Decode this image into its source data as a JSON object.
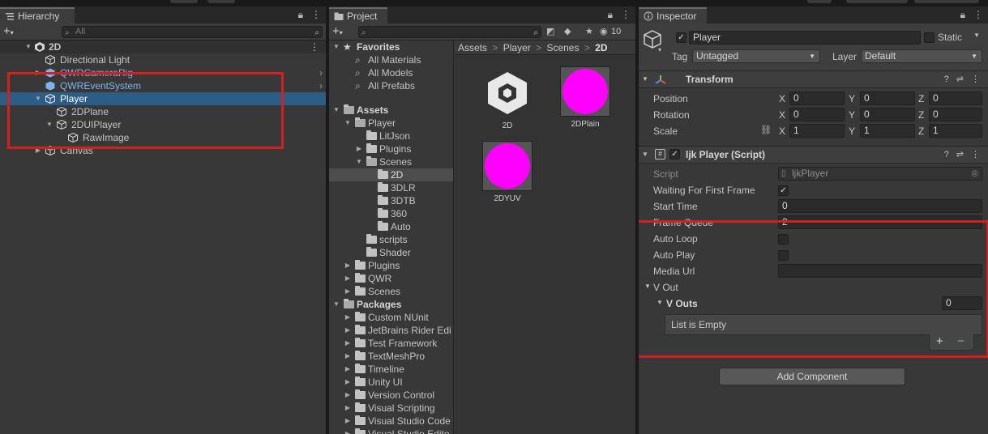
{
  "hierarchy": {
    "tab_label": "Hierarchy",
    "search_placeholder": "All",
    "scene_name": "2D",
    "items": [
      {
        "label": "Directional Light"
      },
      {
        "label": "QWRCameraRig"
      },
      {
        "label": "QWREventSystem"
      },
      {
        "label": "Player"
      },
      {
        "label": "2DPlane"
      },
      {
        "label": "2DUIPlayer"
      },
      {
        "label": "RawImage"
      },
      {
        "label": "Canvas"
      }
    ]
  },
  "project": {
    "tab_label": "Project",
    "hidden_count": "10",
    "favorites_label": "Favorites",
    "favorites": [
      "All Materials",
      "All Models",
      "All Prefabs"
    ],
    "assets_label": "Assets",
    "tree": [
      "Player",
      "LitJson",
      "Plugins",
      "Scenes",
      "2D",
      "3DLR",
      "3DTB",
      "360",
      "Auto",
      "scripts",
      "Shader",
      "Plugins",
      "QWR",
      "Scenes"
    ],
    "packages_label": "Packages",
    "packages": [
      "Custom NUnit",
      "JetBrains Rider Edi",
      "Test Framework",
      "TextMeshPro",
      "Timeline",
      "Unity UI",
      "Version Control",
      "Visual Scripting",
      "Visual Studio Code",
      "Visual Studio Edito"
    ],
    "breadcrumb": [
      "Assets",
      "Player",
      "Scenes",
      "2D"
    ],
    "breadcrumb_sep": ">",
    "assets": [
      {
        "label": "2D"
      },
      {
        "label": "2DPlain"
      },
      {
        "label": "2DYUV"
      }
    ]
  },
  "inspector": {
    "tab_label": "Inspector",
    "object_name": "Player",
    "static_label": "Static",
    "tag_label": "Tag",
    "tag_value": "Untagged",
    "layer_label": "Layer",
    "layer_value": "Default",
    "transform": {
      "title": "Transform",
      "position_label": "Position",
      "rotation_label": "Rotation",
      "scale_label": "Scale",
      "axis_x": "X",
      "axis_y": "Y",
      "axis_z": "Z",
      "position": [
        "0",
        "0",
        "0"
      ],
      "rotation": [
        "0",
        "0",
        "0"
      ],
      "scale": [
        "1",
        "1",
        "1"
      ]
    },
    "script_component": {
      "title": "ljk Player (Script)",
      "script_label": "Script",
      "script_value": "ljkPlayer",
      "waiting_label": "Waiting For First Frame",
      "waiting_checked": true,
      "start_time_label": "Start Time",
      "start_time_value": "0",
      "frame_queue_label": "Frame Queue",
      "frame_queue_value": "2",
      "auto_loop_label": "Auto Loop",
      "auto_play_label": "Auto Play",
      "media_url_label": "Media Url",
      "media_url_value": "",
      "vout_label": "V Out",
      "vouts_label": "V Outs",
      "vouts_count": "0",
      "list_empty_label": "List is Empty",
      "add_label": "+",
      "remove_label": "−"
    },
    "add_component_label": "Add Component"
  },
  "colors": {
    "selection_blue": "#2c5d87",
    "prefab_blue": "#7fb3f0",
    "magenta": "#ff00ff",
    "highlight_red": "#d22020"
  }
}
